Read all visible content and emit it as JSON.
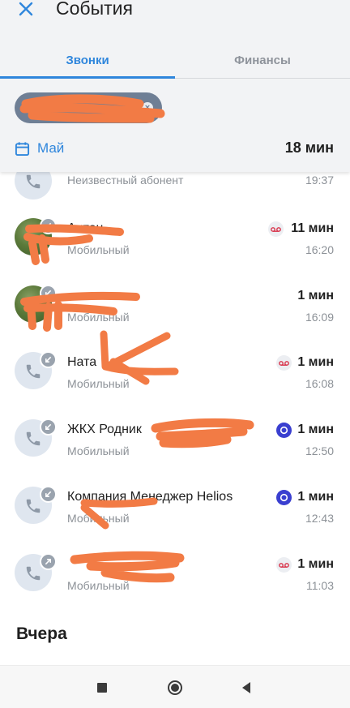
{
  "header": {
    "title": "События",
    "tabs": [
      {
        "label": "Звонки",
        "active": true
      },
      {
        "label": "Финансы",
        "active": false
      }
    ],
    "month_filter": "Май",
    "total_duration": "18 мин"
  },
  "calls": [
    {
      "name": "",
      "subtitle": "Неизвестный абонент",
      "duration": "",
      "time": "19:37",
      "avatar": "phone-icon",
      "badge": ""
    },
    {
      "name": "Антон",
      "subtitle": "Мобильный",
      "duration": "11 мин",
      "time": "16:20",
      "avatar": "photo",
      "badge": "voicemail-icon"
    },
    {
      "name": "",
      "subtitle": "Мобильный",
      "duration": "1 мин",
      "time": "16:09",
      "avatar": "photo",
      "badge": ""
    },
    {
      "name": "Ната",
      "subtitle": "Мобильный",
      "duration": "1 мин",
      "time": "16:08",
      "avatar": "phone-icon",
      "badge": "voicemail-icon"
    },
    {
      "name": "ЖКХ Родник",
      "subtitle": "Мобильный",
      "duration": "1 мин",
      "time": "12:50",
      "avatar": "phone-icon",
      "badge": "operator-icon"
    },
    {
      "name": "Компания Менеджер Helios",
      "subtitle": "Мобильный",
      "duration": "1 мин",
      "time": "12:43",
      "avatar": "phone-icon",
      "badge": "operator-icon"
    },
    {
      "name": "",
      "subtitle": "Мобильный",
      "duration": "1 мин",
      "time": "11:03",
      "avatar": "phone-icon",
      "badge": "voicemail-icon"
    }
  ],
  "section_label": "Вчера",
  "colors": {
    "accent": "#2f86dc",
    "redaction": "#f27b45",
    "operator_badge": "#3a3fd0",
    "voicemail_badge": "#d8334a"
  }
}
